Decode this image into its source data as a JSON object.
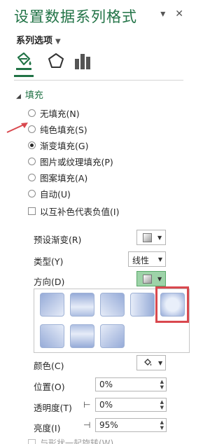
{
  "panel": {
    "title": "设置数据系列格式",
    "series_options": "系列选项"
  },
  "fill": {
    "header": "填充",
    "options": [
      "无填充(N)",
      "纯色填充(S)",
      "渐变填充(G)",
      "图片或纹理填充(P)",
      "图案填充(A)",
      "自动(U)"
    ],
    "selected_index": 2,
    "invert_label": "以互补色代表负值(I)"
  },
  "gradient": {
    "preset_label": "预设渐变(R)",
    "type_label": "类型(Y)",
    "type_value": "线性",
    "direction_label": "方向(D)",
    "color_label": "颜色(C)",
    "position_label": "位置(O)",
    "position_value": "0%",
    "transparency_label": "透明度(T)",
    "transparency_value": "0%",
    "brightness_label": "亮度(I)",
    "brightness_value": "95%",
    "rotate_label": "与形状一起旋转(W)"
  },
  "colors": {
    "accent": "#217346",
    "highlight": "#d9484e",
    "active_button": "#9dd3a8"
  }
}
